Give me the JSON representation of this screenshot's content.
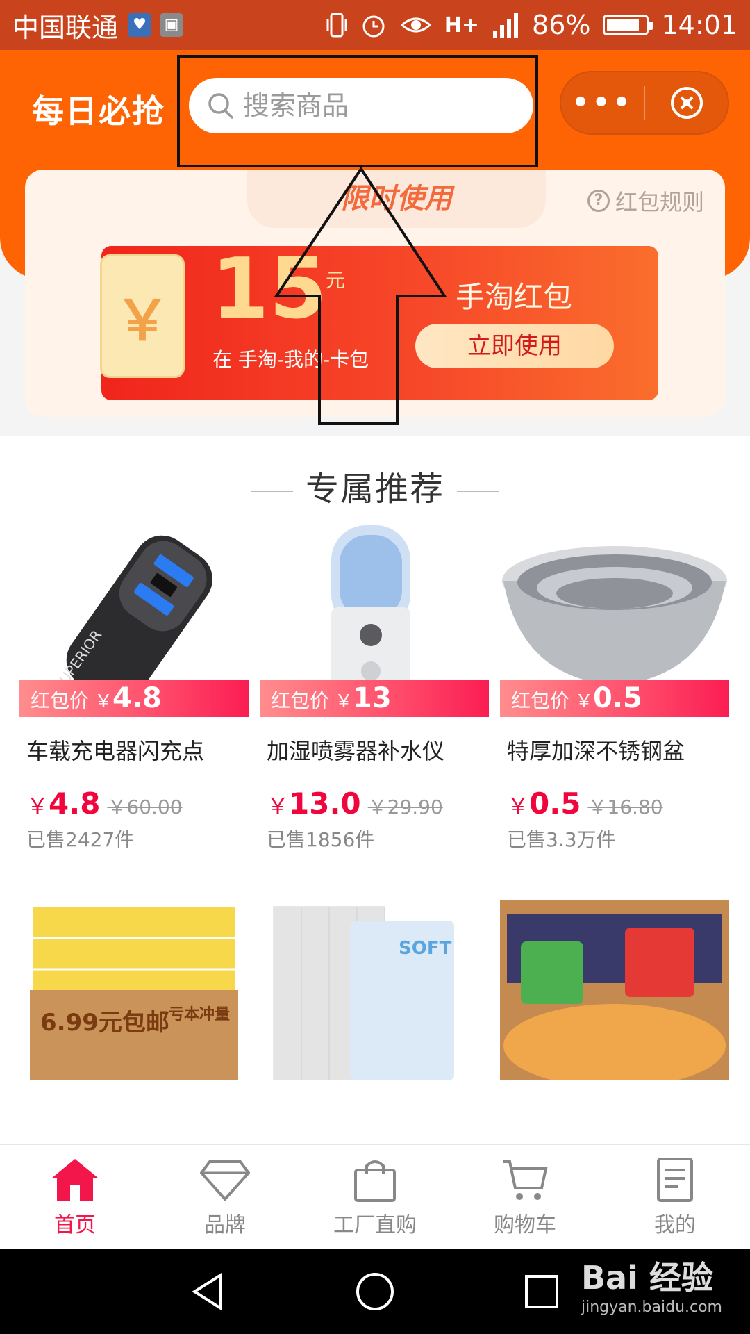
{
  "status_bar": {
    "carrier": "中国联通",
    "network": "H+",
    "battery": "86%",
    "battery_level": 0.86,
    "time": "14:01"
  },
  "header": {
    "app_title": "每日必抢",
    "search_placeholder": "搜索商品",
    "more_label": "•••"
  },
  "coupon": {
    "tab_label": "限时使用",
    "rules_label": "红包规则",
    "amount": "15",
    "unit": "元",
    "where": "在 手淘-我的-卡包",
    "name": "手淘红包",
    "use_button": "立即使用",
    "yen_symbol": "￥"
  },
  "recommend": {
    "title": "专属推荐",
    "tag_label": "红包价",
    "yen": "￥",
    "products": [
      {
        "tag_price": "4.8",
        "name": "车载充电器闪充点",
        "price": "4.8",
        "original": "￥60.00",
        "sold": "已售2427件",
        "img": "car-charger"
      },
      {
        "tag_price": "13",
        "name": "加湿喷雾器补水仪",
        "price": "13.0",
        "original": "￥29.90",
        "sold": "已售1856件",
        "img": "humidifier"
      },
      {
        "tag_price": "0.5",
        "name": "特厚加深不锈钢盆",
        "price": "0.5",
        "original": "￥16.80",
        "sold": "已售3.3万件",
        "img": "steel-bowl"
      }
    ],
    "products_row2": [
      {
        "img": "tissue-box",
        "print": "6.99元包邮",
        "side": "亏本冲量"
      },
      {
        "img": "toilet-paper",
        "print": "SOFT"
      },
      {
        "img": "snacks"
      }
    ]
  },
  "tabbar": {
    "items": [
      {
        "label": "首页",
        "icon": "home-icon",
        "active": true
      },
      {
        "label": "品牌",
        "icon": "diamond-icon",
        "active": false
      },
      {
        "label": "工厂直购",
        "icon": "bag-icon",
        "active": false
      },
      {
        "label": "购物车",
        "icon": "cart-icon",
        "active": false
      },
      {
        "label": "我的",
        "icon": "document-icon",
        "active": false
      }
    ]
  },
  "watermark": {
    "brand": "Bai 经验",
    "url": "jingyan.baidu.com"
  },
  "colors": {
    "header": "#fe6404",
    "status_bar": "#c9431c",
    "accent": "#f3164a",
    "price": "#f0063d"
  }
}
